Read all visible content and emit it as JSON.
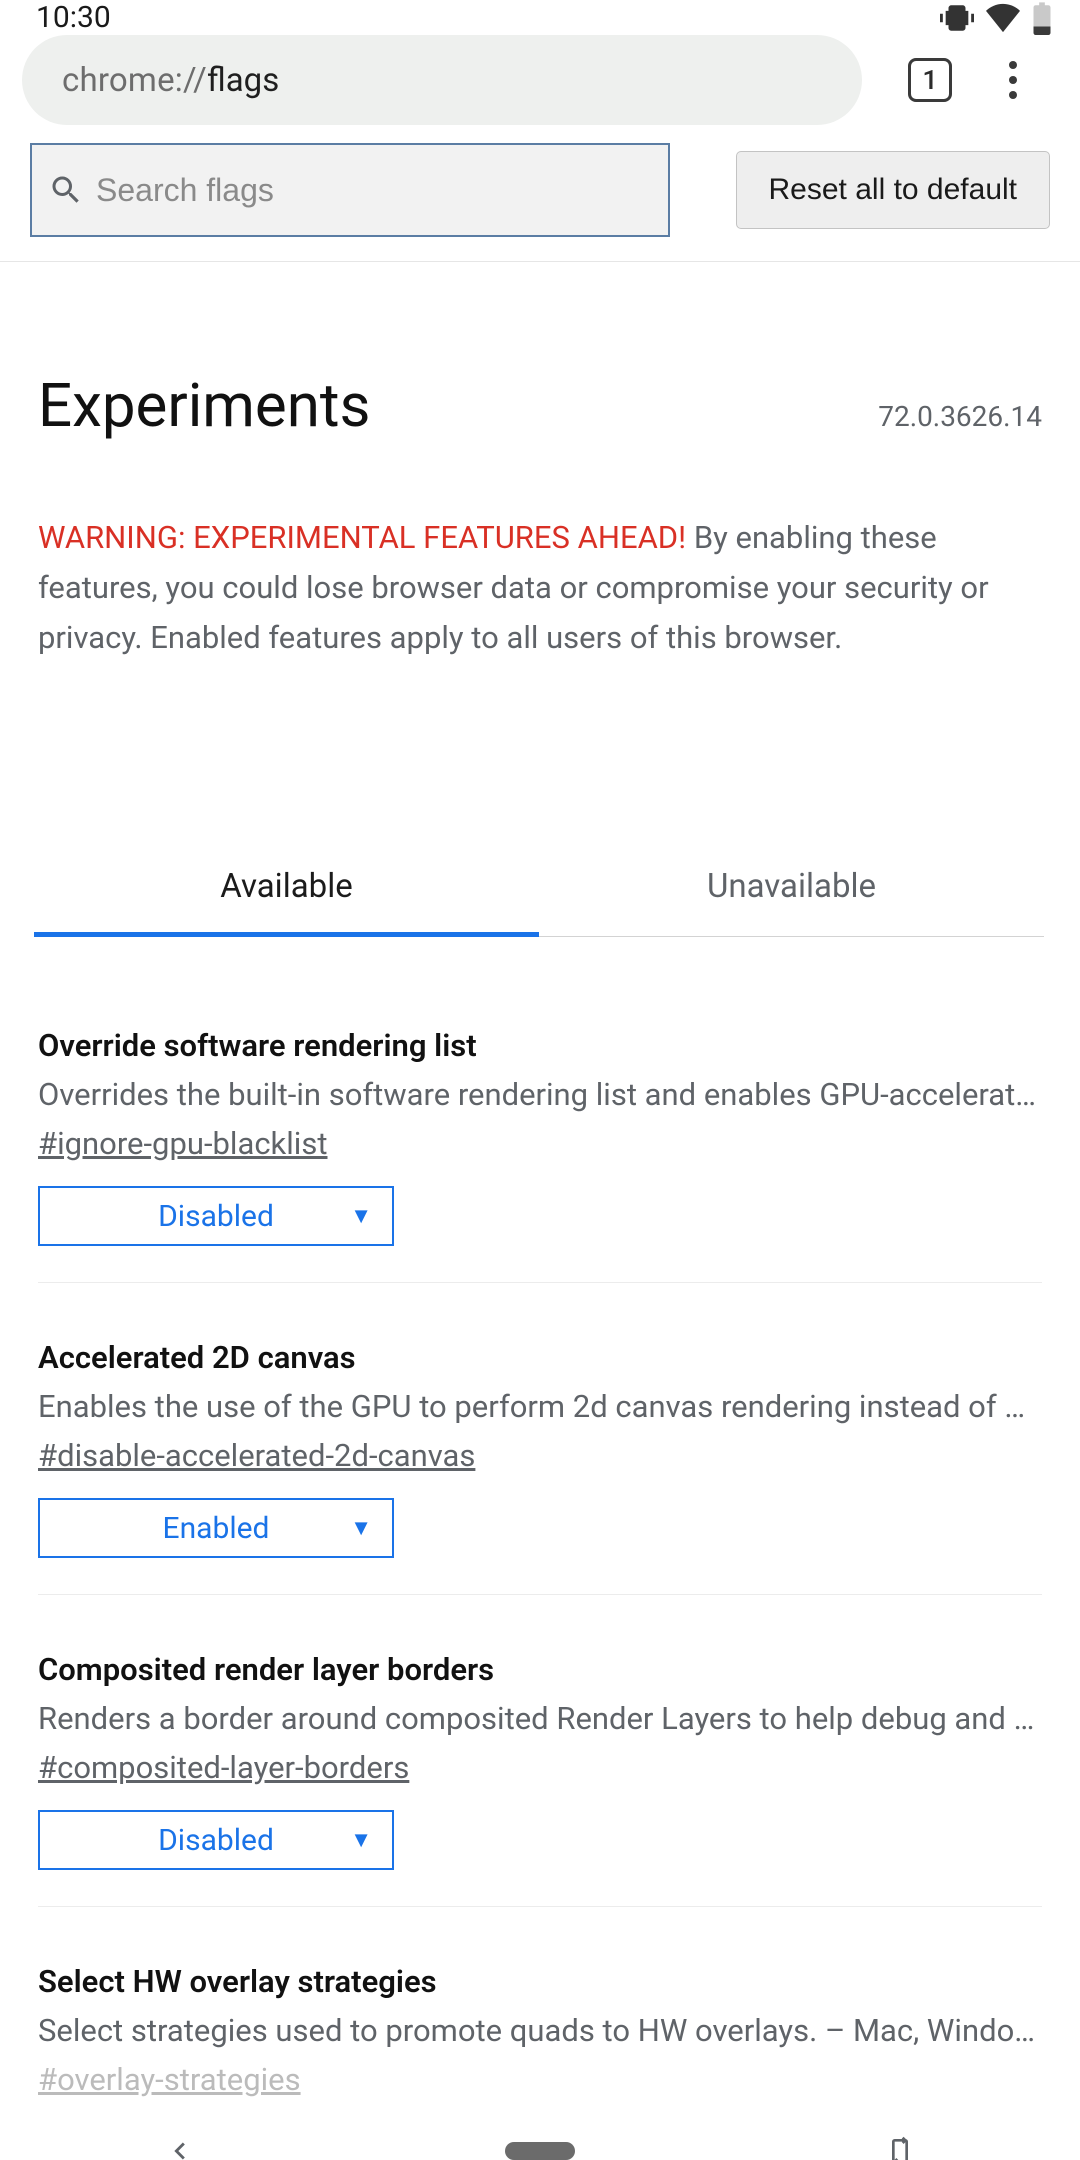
{
  "status": {
    "time": "10:30"
  },
  "chrome": {
    "url_prefix": "chrome://",
    "url_path": "flags",
    "tab_count": "1"
  },
  "toolbar": {
    "search_placeholder": "Search flags",
    "reset_label": "Reset all to default"
  },
  "header": {
    "title": "Experiments",
    "version": "72.0.3626.14"
  },
  "warning": {
    "strong": "WARNING: EXPERIMENTAL FEATURES AHEAD!",
    "rest": " By enabling these features, you could lose browser data or compromise your security or privacy. Enabled features apply to all users of this browser."
  },
  "tabs": {
    "available": "Available",
    "unavailable": "Unavailable"
  },
  "flags": [
    {
      "title": "Override software rendering list",
      "desc": "Overrides the built-in software rendering list and enables GPU-accelerat…",
      "hash": "#ignore-gpu-blacklist",
      "value": "Disabled"
    },
    {
      "title": "Accelerated 2D canvas",
      "desc": "Enables the use of the GPU to perform 2d canvas rendering instead of …",
      "hash": "#disable-accelerated-2d-canvas",
      "value": "Enabled"
    },
    {
      "title": "Composited render layer borders",
      "desc": "Renders a border around composited Render Layers to help debug and …",
      "hash": "#composited-layer-borders",
      "value": "Disabled"
    },
    {
      "title": "Select HW overlay strategies",
      "desc": "Select strategies used to promote quads to HW overlays. – Mac, Windo…",
      "hash": "#overlay-strategies",
      "value": ""
    }
  ]
}
